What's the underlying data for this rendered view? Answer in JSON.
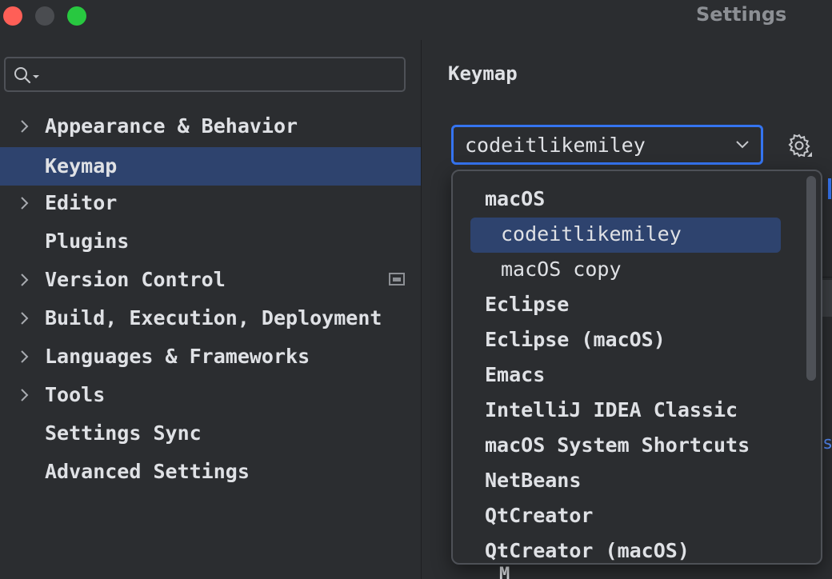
{
  "window": {
    "title": "Settings"
  },
  "sidebar": {
    "search": {
      "value": "",
      "placeholder": ""
    },
    "items": [
      {
        "label": "Appearance & Behavior",
        "expandable": true,
        "selected": false
      },
      {
        "label": "Keymap",
        "expandable": false,
        "selected": true
      },
      {
        "label": "Editor",
        "expandable": true,
        "selected": false
      },
      {
        "label": "Plugins",
        "expandable": false,
        "selected": false
      },
      {
        "label": "Version Control",
        "expandable": true,
        "selected": false,
        "badge_icon": "window-icon"
      },
      {
        "label": "Build, Execution, Deployment",
        "expandable": true,
        "selected": false
      },
      {
        "label": "Languages & Frameworks",
        "expandable": true,
        "selected": false
      },
      {
        "label": "Tools",
        "expandable": true,
        "selected": false
      },
      {
        "label": "Settings Sync",
        "expandable": false,
        "selected": false
      },
      {
        "label": "Advanced Settings",
        "expandable": false,
        "selected": false
      }
    ]
  },
  "main": {
    "title": "Keymap",
    "keymap_select": {
      "value": "codeitlikemiley"
    },
    "partial_link_text": "s",
    "partial_bottom_text": "M"
  },
  "dropdown": {
    "options": [
      {
        "label": "macOS",
        "group_header": true
      },
      {
        "label": "codeitlikemiley",
        "child": true,
        "selected": true
      },
      {
        "label": "macOS copy",
        "child": true,
        "selected": false
      },
      {
        "label": "Eclipse"
      },
      {
        "label": "Eclipse (macOS)"
      },
      {
        "label": "Emacs"
      },
      {
        "label": "IntelliJ IDEA Classic"
      },
      {
        "label": "macOS System Shortcuts"
      },
      {
        "label": "NetBeans"
      },
      {
        "label": "QtCreator"
      },
      {
        "label": "QtCreator (macOS)"
      }
    ]
  },
  "colors": {
    "background": "#2b2d30",
    "selection": "#2e436e",
    "accent": "#3574f0",
    "text": "#dfe1e5",
    "muted": "#8c8f94",
    "close": "#ff5f57",
    "maximize": "#28c840"
  }
}
